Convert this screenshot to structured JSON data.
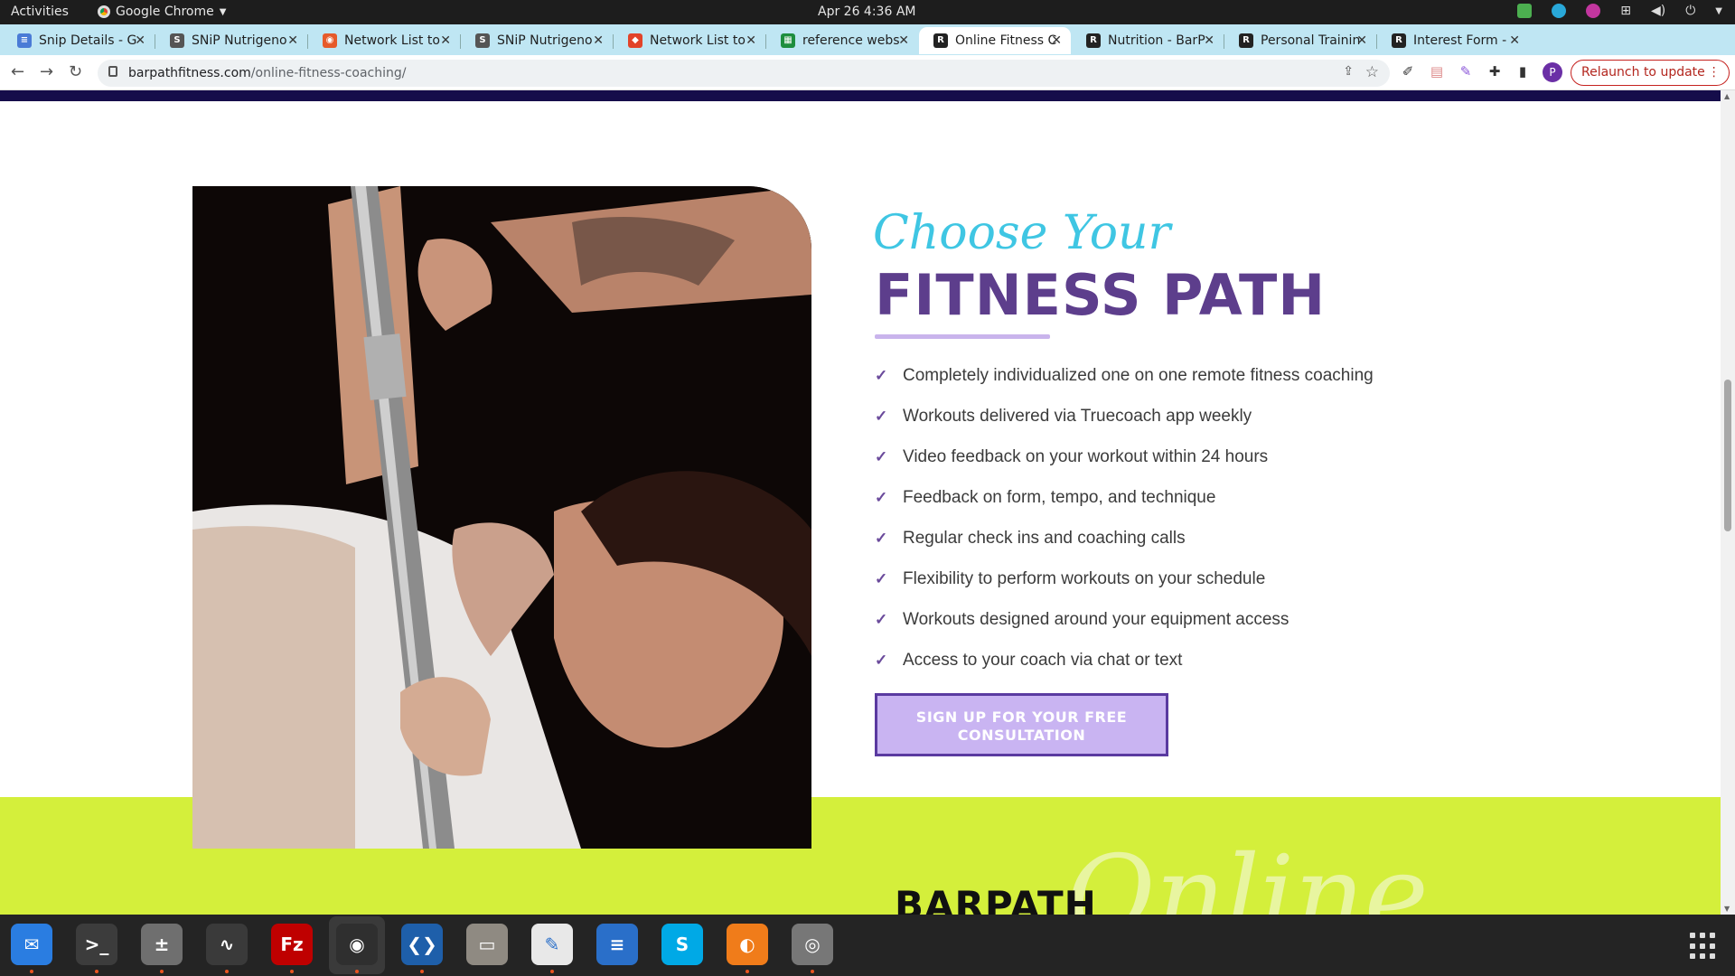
{
  "topbar": {
    "activities": "Activities",
    "app_name": "Google Chrome",
    "clock": "Apr 26  4:36 AM"
  },
  "tabs": [
    {
      "title": "Snip Details - G",
      "fav": "docs",
      "color": "#4a7bd6"
    },
    {
      "title": "SNiP Nutrigeno",
      "fav": "snip",
      "color": "#555555"
    },
    {
      "title": "Network List to",
      "fav": "chrome",
      "color": "#e65a2a"
    },
    {
      "title": "SNiP Nutrigeno",
      "fav": "snip",
      "color": "#555555"
    },
    {
      "title": "Network List to",
      "fav": "gitlab",
      "color": "#e24329"
    },
    {
      "title": "reference webs",
      "fav": "sheets",
      "color": "#1e8e3e"
    },
    {
      "title": "Online Fitness C",
      "fav": "rpl",
      "color": "#222222",
      "active": true
    },
    {
      "title": "Nutrition - BarP",
      "fav": "rpl",
      "color": "#222222"
    },
    {
      "title": "Personal Trainin",
      "fav": "rpl",
      "color": "#222222"
    },
    {
      "title": "Interest Form -",
      "fav": "rpl",
      "color": "#222222"
    }
  ],
  "address_bar": {
    "domain": "barpathfitness.com",
    "path": "/online-fitness-coaching/"
  },
  "relaunch_label": "Relaunch to update",
  "profile_initial": "P",
  "content": {
    "script_heading": "Choose Your",
    "main_heading": "FITNESS PATH",
    "features": [
      "Completely individualized one on one remote fitness coaching",
      "Workouts delivered via Truecoach app weekly",
      "Video feedback on your workout within 24 hours",
      "Feedback on form, tempo, and technique",
      "Regular check ins and coaching calls",
      "Flexibility to perform workouts on your schedule",
      "Workouts designed around your equipment access",
      "Access to your coach via chat or text"
    ],
    "cta_label": "SIGN UP FOR YOUR FREE CONSULTATION",
    "footer_brand": "BARPATH",
    "footer_script": "Online"
  },
  "colors": {
    "accent_purple": "#5d3e8c",
    "script_cyan": "#3fc6e3",
    "lime": "#d4ef3b",
    "navy": "#150d4a"
  },
  "dock": [
    {
      "name": "thunderbird-icon",
      "color": "#2a7de1",
      "glyph": "✉"
    },
    {
      "name": "terminal-icon",
      "color": "#3c3c3c",
      "glyph": ">_"
    },
    {
      "name": "calculator-icon",
      "color": "#6f6f6f",
      "glyph": "±"
    },
    {
      "name": "system-monitor-icon",
      "color": "#3a3a3a",
      "glyph": "∿"
    },
    {
      "name": "filezilla-icon",
      "color": "#bf0000",
      "glyph": "Fz"
    },
    {
      "name": "chrome-icon",
      "color": "#2f2f2f",
      "glyph": "◉"
    },
    {
      "name": "vscode-icon",
      "color": "#1e5faa",
      "glyph": "❮❯"
    },
    {
      "name": "files-icon",
      "color": "#8f8a82",
      "glyph": "▭"
    },
    {
      "name": "text-editor-icon",
      "color": "#e8e8e8",
      "glyph": "✎"
    },
    {
      "name": "libreoffice-writer-icon",
      "color": "#2a6fc9",
      "glyph": "≡"
    },
    {
      "name": "skype-icon",
      "color": "#00a9e6",
      "glyph": "S"
    },
    {
      "name": "blender-like-icon",
      "color": "#f07c1a",
      "glyph": "◐"
    },
    {
      "name": "disk-icon",
      "color": "#777777",
      "glyph": "◎"
    }
  ]
}
